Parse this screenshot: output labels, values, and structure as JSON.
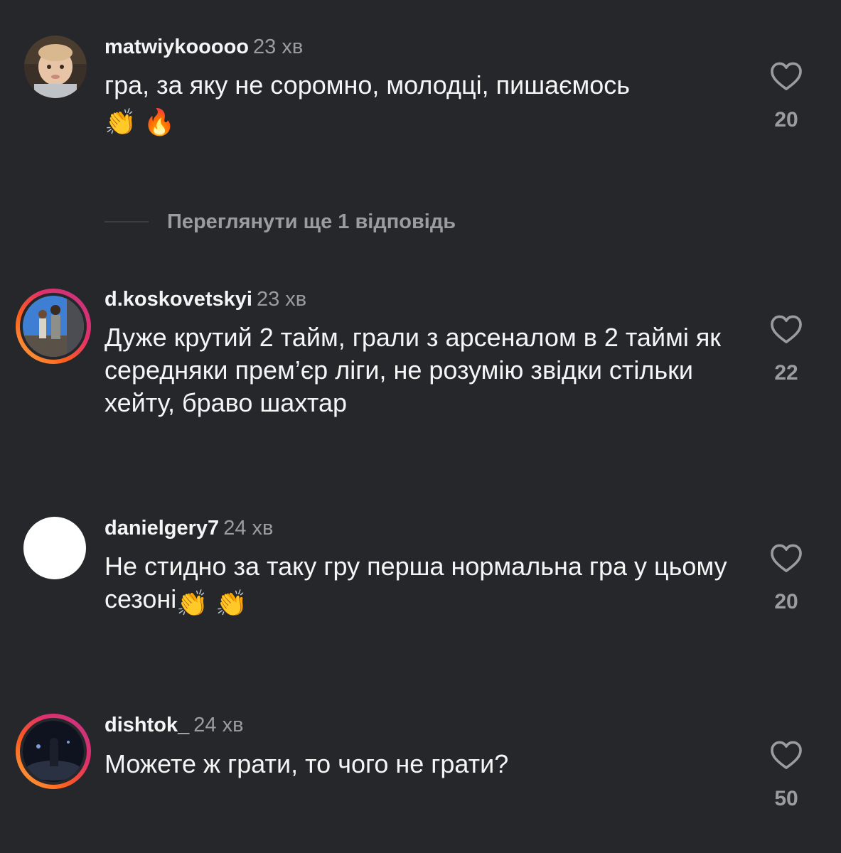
{
  "comments": [
    {
      "username": "matwiykooooo",
      "time": "23 хв",
      "text": "гра, за яку не соромно, молодці, пишаємось",
      "emojis": [
        "👏",
        "🔥"
      ],
      "likes": "20",
      "story_ring": false,
      "avatar": "toddler-photo"
    },
    {
      "username": "d.koskovetskyi",
      "time": "23 хв",
      "text": "Дуже крутий 2 тайм, грали з арсеналом в 2 таймі як середняки прем’єр ліги, не розумію звідки стільки хейту, браво шахтар",
      "emojis": [],
      "likes": "22",
      "story_ring": true,
      "avatar": "two-people-outdoor-photo"
    },
    {
      "username": "danielgery7",
      "time": "24 хв",
      "text": "Не стидно за таку гру перша нормальна гра у цьому сезоні",
      "emojis": [
        "👏",
        "👏"
      ],
      "likes": "20",
      "story_ring": false,
      "avatar": "blank-white"
    },
    {
      "username": "dishtok_",
      "time": "24 хв",
      "text": "Можете ж грати, то чого не грати?",
      "emojis": [],
      "likes": "50",
      "story_ring": true,
      "avatar": "night-street-photo"
    }
  ],
  "view_replies": {
    "label": "Переглянути ще 1 відповідь"
  },
  "colors": {
    "background": "#25272b",
    "primary_text": "#f5f5f5",
    "secondary_text": "#9a9ca1",
    "story_ring": [
      "#fcb045",
      "#fd5e1d",
      "#e1306c",
      "#c13584"
    ]
  }
}
